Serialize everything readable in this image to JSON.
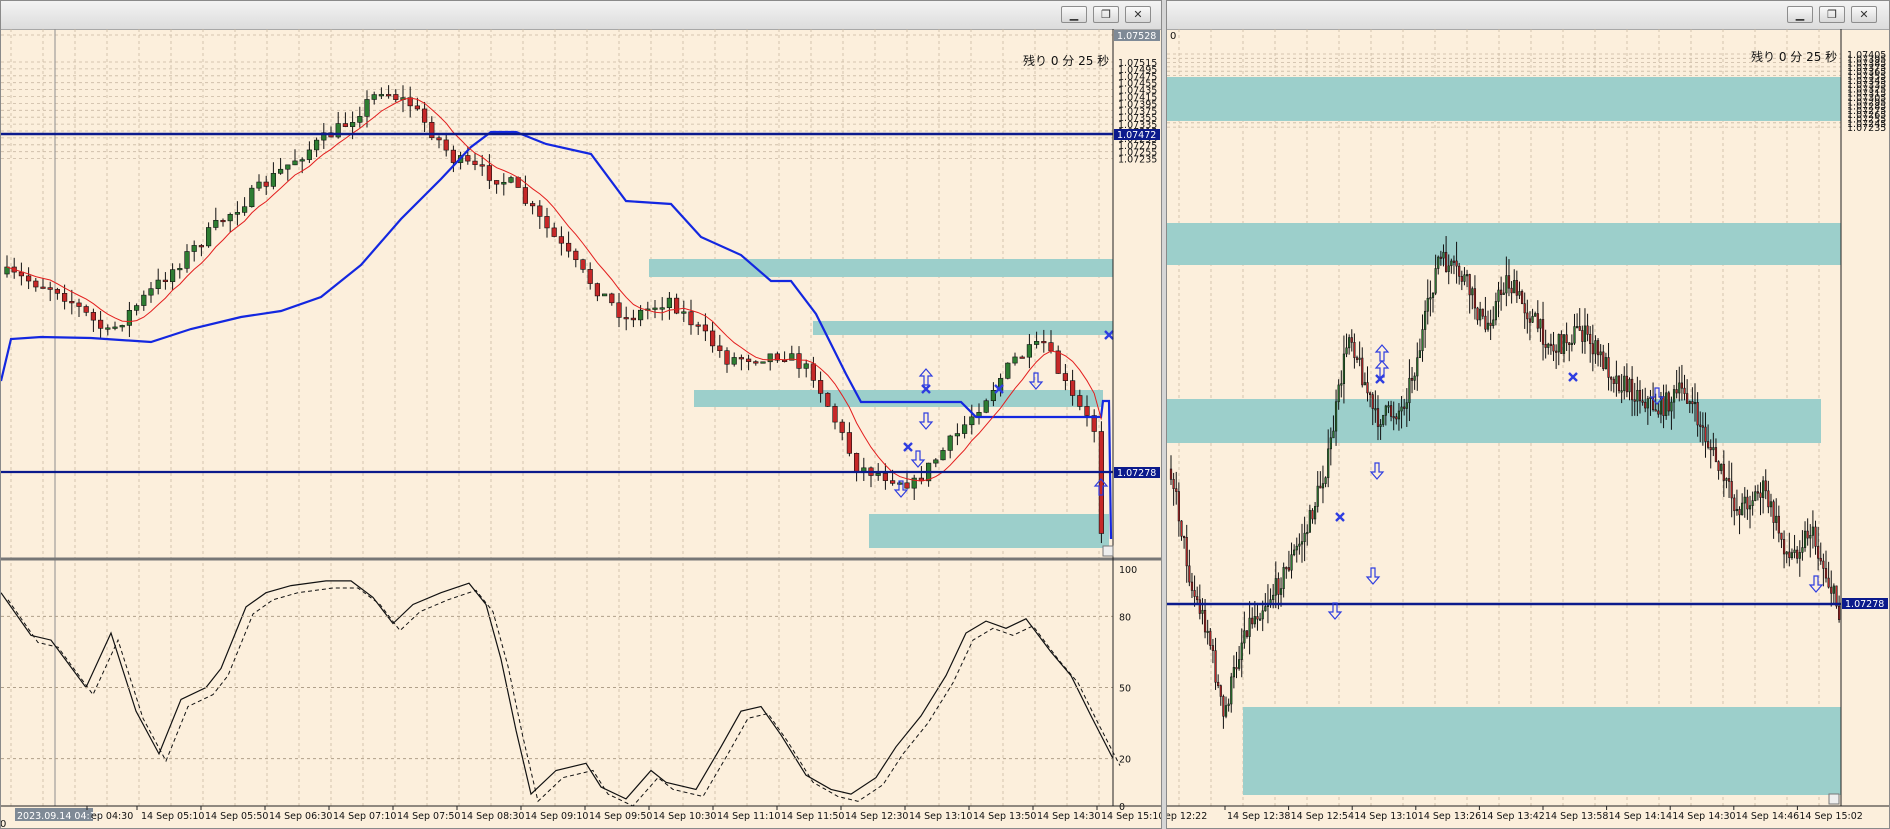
{
  "window_left": {
    "countdown": "残り 0 分 25 秒",
    "price_ticks": [
      "1.07528",
      "1.07515",
      "1.07495",
      "1.07475",
      "1.07455",
      "1.07435",
      "1.07415",
      "1.07395",
      "1.07375",
      "1.07355",
      "1.07335",
      "1.07315",
      "1.07295",
      "1.07275",
      "1.07255",
      "1.07235"
    ],
    "price_current": "1.07528",
    "hline_top_label": "1.07472",
    "hline_low_label": "1.07278",
    "osc_ticks": [
      "100",
      "80",
      "50",
      "20",
      "0"
    ],
    "time_labels": [
      "2023.09.14 04:15",
      "ep 04:30",
      "14 Sep 05:10",
      "14 Sep 05:50",
      "14 Sep 06:30",
      "14 Sep 07:10",
      "14 Sep 07:50",
      "14 Sep 08:30",
      "14 Sep 09:10",
      "14 Sep 09:50",
      "14 Sep 10:30",
      "14 Sep 11:10",
      "14 Sep 11:50",
      "14 Sep 12:30",
      "14 Sep 13:10",
      "14 Sep 13:50",
      "14 Sep 14:30",
      "14 Sep 15:10"
    ],
    "left_edge_label": "0"
  },
  "window_right": {
    "countdown": "残り 0 分 25 秒",
    "top_left_label": "0",
    "price_ticks": [
      "1.07405",
      "1.07395",
      "1.07385",
      "1.07375",
      "1.07365",
      "1.07355",
      "1.07345",
      "1.07335",
      "1.07325",
      "1.07315",
      "1.07305",
      "1.07295",
      "1.07285",
      "1.07275",
      "1.07265",
      "1.07255",
      "1.07245",
      "1.07235"
    ],
    "hline_label": "1.07278",
    "time_labels": [
      "ep 12:22",
      "14 Sep 12:38",
      "14 Sep 12:54",
      "14 Sep 13:10",
      "14 Sep 13:26",
      "14 Sep 13:42",
      "14 Sep 13:58",
      "14 Sep 14:14",
      "14 Sep 14:30",
      "14 Sep 14:46",
      "14 Sep 15:02"
    ]
  },
  "icons": {
    "minimize": "minimize-icon",
    "restore": "restore-icon",
    "close": "close-icon"
  },
  "colors": {
    "chart_bg": "#fcefdc",
    "bull_candle": "#2e7d32",
    "bear_candle": "#c62828",
    "supply_demand_zone": "#9ccfcb",
    "horizontal_line": "#0b1a8c",
    "fast_ma": "#e31e1e",
    "slow_line": "#1327e0",
    "signal_arrow": "#2e3de0"
  }
}
